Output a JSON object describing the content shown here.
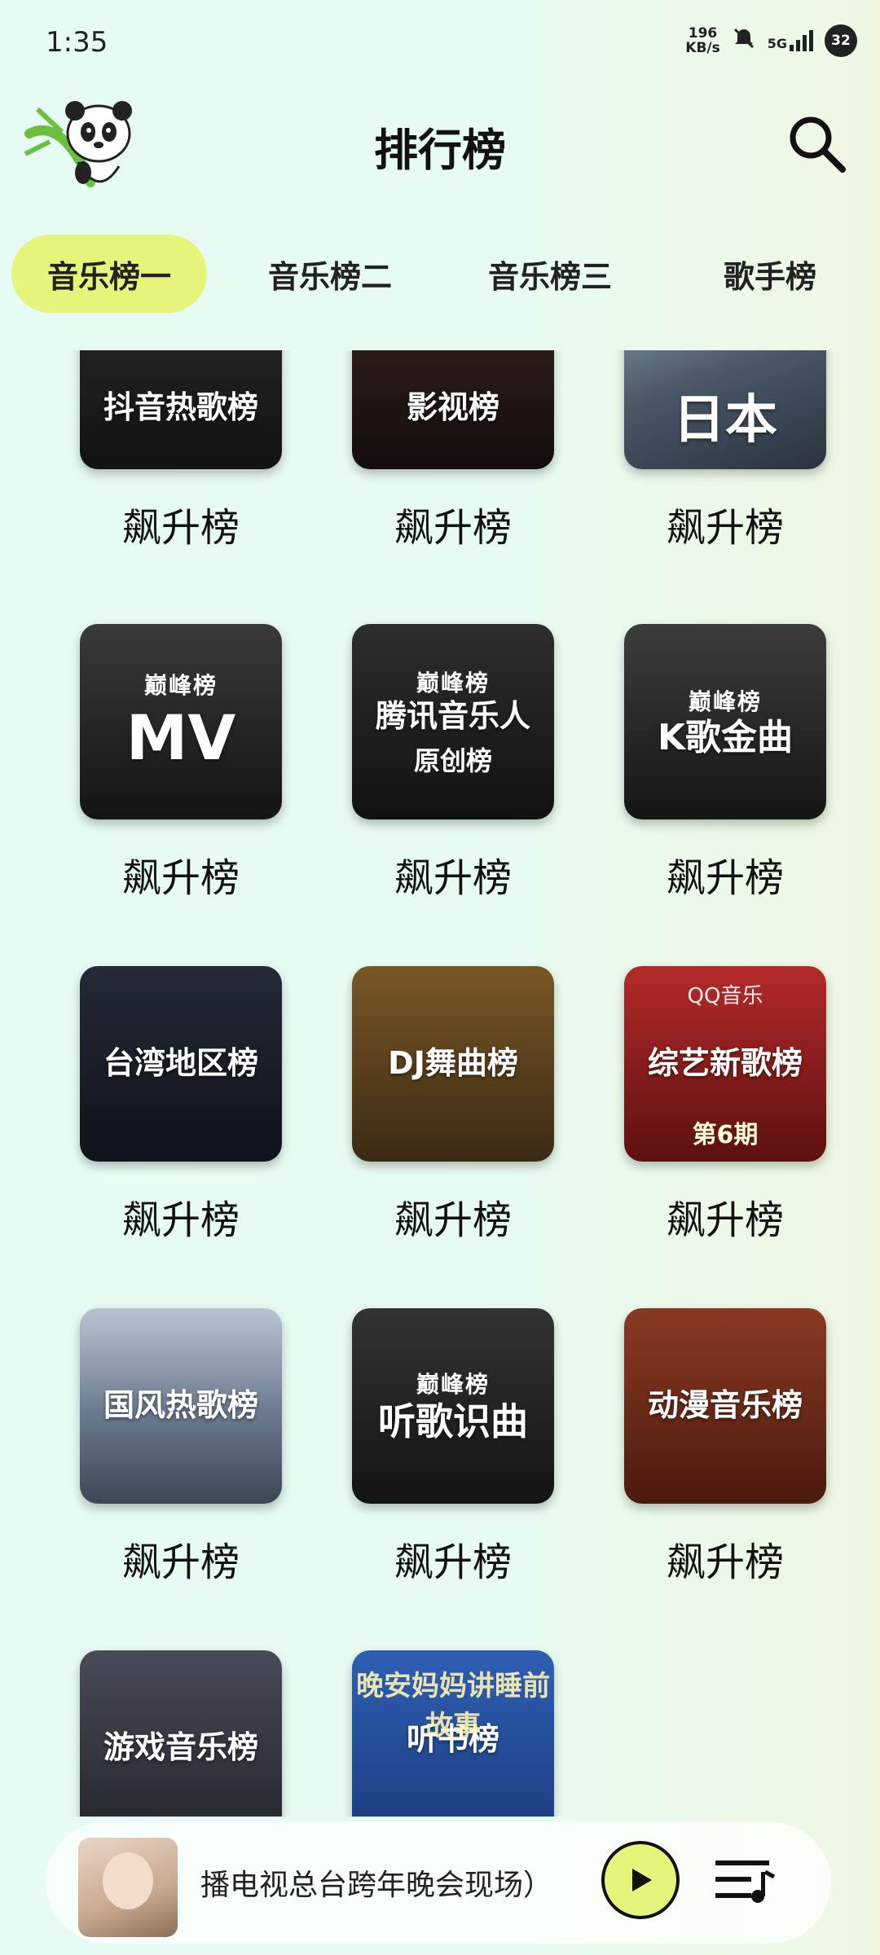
{
  "status": {
    "time": "1:35",
    "net_speed_value": "196",
    "net_speed_unit": "KB/s",
    "network": "5G",
    "battery": "32"
  },
  "header": {
    "title": "排行榜"
  },
  "tabs": [
    {
      "label": "音乐榜一",
      "active": true
    },
    {
      "label": "音乐榜二",
      "active": false
    },
    {
      "label": "音乐榜三",
      "active": false
    },
    {
      "label": "歌手榜",
      "active": false
    }
  ],
  "charts": [
    {
      "cover_title": "抖音热歌榜",
      "label": "飙升榜"
    },
    {
      "cover_title": "影视榜",
      "label": "飙升榜"
    },
    {
      "cover_title": "日本",
      "label": "飙升榜"
    },
    {
      "cover_brand": "巅峰榜",
      "cover_title": "MV",
      "label": "飙升榜"
    },
    {
      "cover_brand": "巅峰榜",
      "cover_title": "腾讯音乐人",
      "cover_sub": "原创榜",
      "label": "飙升榜"
    },
    {
      "cover_brand": "巅峰榜",
      "cover_title": "K歌金曲",
      "label": "飙升榜"
    },
    {
      "cover_title": "台湾地区榜",
      "label": "飙升榜"
    },
    {
      "cover_title": "DJ舞曲榜",
      "label": "飙升榜"
    },
    {
      "cover_top": "QQ音乐",
      "cover_title": "综艺新歌榜",
      "cover_bottom": "第6期",
      "label": "飙升榜"
    },
    {
      "cover_title": "国风热歌榜",
      "label": "飙升榜"
    },
    {
      "cover_brand": "巅峰榜",
      "cover_title": "听歌识曲",
      "label": "飙升榜"
    },
    {
      "cover_title": "动漫音乐榜",
      "label": "飙升榜"
    },
    {
      "cover_title": "游戏音乐榜",
      "label": ""
    },
    {
      "cover_top": "晚安妈妈讲睡前故事",
      "cover_title": "听书榜",
      "label": ""
    }
  ],
  "player": {
    "track_title": "播电视总台跨年晚会现场）"
  },
  "colors": {
    "accent": "#e6f47a",
    "text": "#111111"
  }
}
